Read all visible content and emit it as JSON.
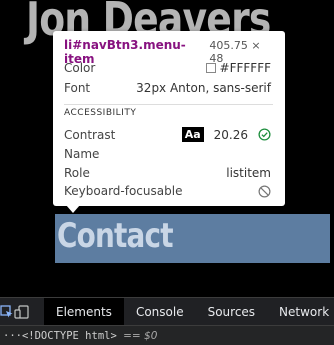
{
  "page": {
    "site_title": "Jon Deavers",
    "nav_item_label": "Contact"
  },
  "tooltip": {
    "selector": "li#navBtn3.menu-item",
    "dimensions": "405.75 × 48",
    "color_label": "Color",
    "color_value": "#FFFFFF",
    "font_label": "Font",
    "font_value": "32px Anton, sans-serif",
    "accessibility_heading": "ACCESSIBILITY",
    "contrast_label": "Contrast",
    "contrast_badge": "Aa",
    "contrast_value": "20.26",
    "name_label": "Name",
    "role_label": "Role",
    "role_value": "listitem",
    "keyboard_label": "Keyboard-focusable"
  },
  "devtools": {
    "tabs": [
      {
        "label": "Elements",
        "active": true
      },
      {
        "label": "Console",
        "active": false
      },
      {
        "label": "Sources",
        "active": false
      },
      {
        "label": "Network",
        "active": false
      }
    ],
    "status_ellipsis": "···",
    "status_doctype": "<!DOCTYPE html>",
    "status_eq": "== $0"
  },
  "colors": {
    "highlight": "#5d7da1",
    "selector": "#881280",
    "check": "#1e8e3e",
    "devtools_bg": "#202124"
  }
}
